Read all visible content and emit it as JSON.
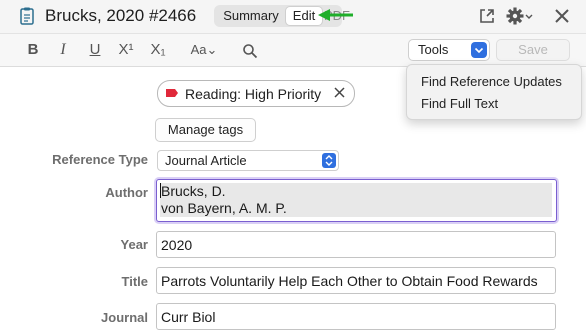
{
  "titlebar": {
    "title": "Brucks, 2020 #2466",
    "tabs": [
      "Summary",
      "Edit",
      "PDF"
    ],
    "active_tab": "Edit"
  },
  "toolbar": {
    "bold": "B",
    "italic": "I",
    "underline": "U",
    "superscript": "X¹",
    "subscript": "X₁",
    "font_size": "Aa⌄",
    "tools_label": "Tools",
    "save_label": "Save"
  },
  "tools_menu": {
    "items": [
      "Find Reference Updates",
      "Find Full Text"
    ]
  },
  "tags": {
    "tag_label": "Reading: High Priority",
    "tag_color": "#e0283a",
    "manage_label": "Manage tags"
  },
  "form": {
    "reference_type_label": "Reference Type",
    "reference_type_value": "Journal Article",
    "author_label": "Author",
    "authors": [
      "Brucks, D.",
      "von Bayern, A. M. P."
    ],
    "year_label": "Year",
    "year_value": "2020",
    "title_label": "Title",
    "title_value": "Parrots Voluntarily Help Each Other to Obtain Food Rewards",
    "journal_label": "Journal",
    "journal_value": "Curr Biol"
  },
  "colors": {
    "accent": "#2f6fdf",
    "arrow": "#1fae2a",
    "focus": "#7a5fd0"
  }
}
